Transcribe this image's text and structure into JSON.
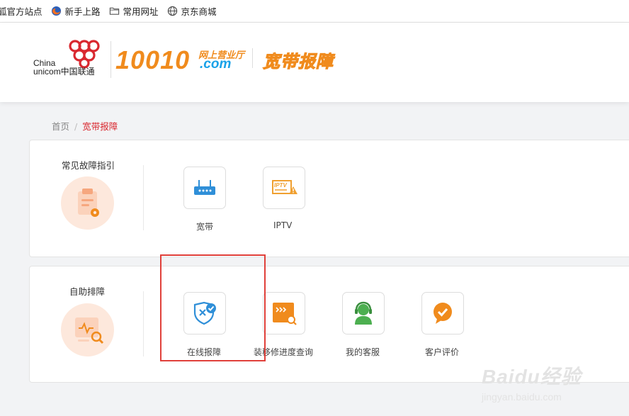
{
  "bookmarks": [
    {
      "label": "狐官方站点",
      "icon": "sohu-fox-icon"
    },
    {
      "label": "新手上路",
      "icon": "firefox-icon"
    },
    {
      "label": "常用网址",
      "icon": "folder-icon"
    },
    {
      "label": "京东商城",
      "icon": "globe-icon"
    }
  ],
  "header": {
    "logo_line1": "China",
    "logo_line2": "unicom中国联通",
    "number": "10010",
    "tagline": "网上营业厅",
    "domain": ".com",
    "section_title": "宽带报障"
  },
  "breadcrumb": {
    "home": "首页",
    "separator": "/",
    "current": "宽带报障"
  },
  "panel1": {
    "title": "常见故障指引",
    "items": [
      {
        "label": "宽带",
        "icon": "router-icon"
      },
      {
        "label": "IPTV",
        "icon": "iptv-icon"
      }
    ]
  },
  "panel2": {
    "title": "自助排障",
    "items": [
      {
        "label": "在线报障",
        "icon": "shield-check-icon"
      },
      {
        "label": "装移修进度查询",
        "icon": "progress-search-icon"
      },
      {
        "label": "我的客服",
        "icon": "customer-service-icon"
      },
      {
        "label": "客户评价",
        "icon": "rating-check-icon"
      }
    ]
  },
  "watermark": {
    "main": "Baidu经验",
    "sub": "jingyan.baidu.com"
  },
  "colors": {
    "accent_orange": "#f08b1d",
    "accent_blue": "#1aa2e8",
    "highlight_red": "#e0403a",
    "brand_red": "#d9282f"
  }
}
